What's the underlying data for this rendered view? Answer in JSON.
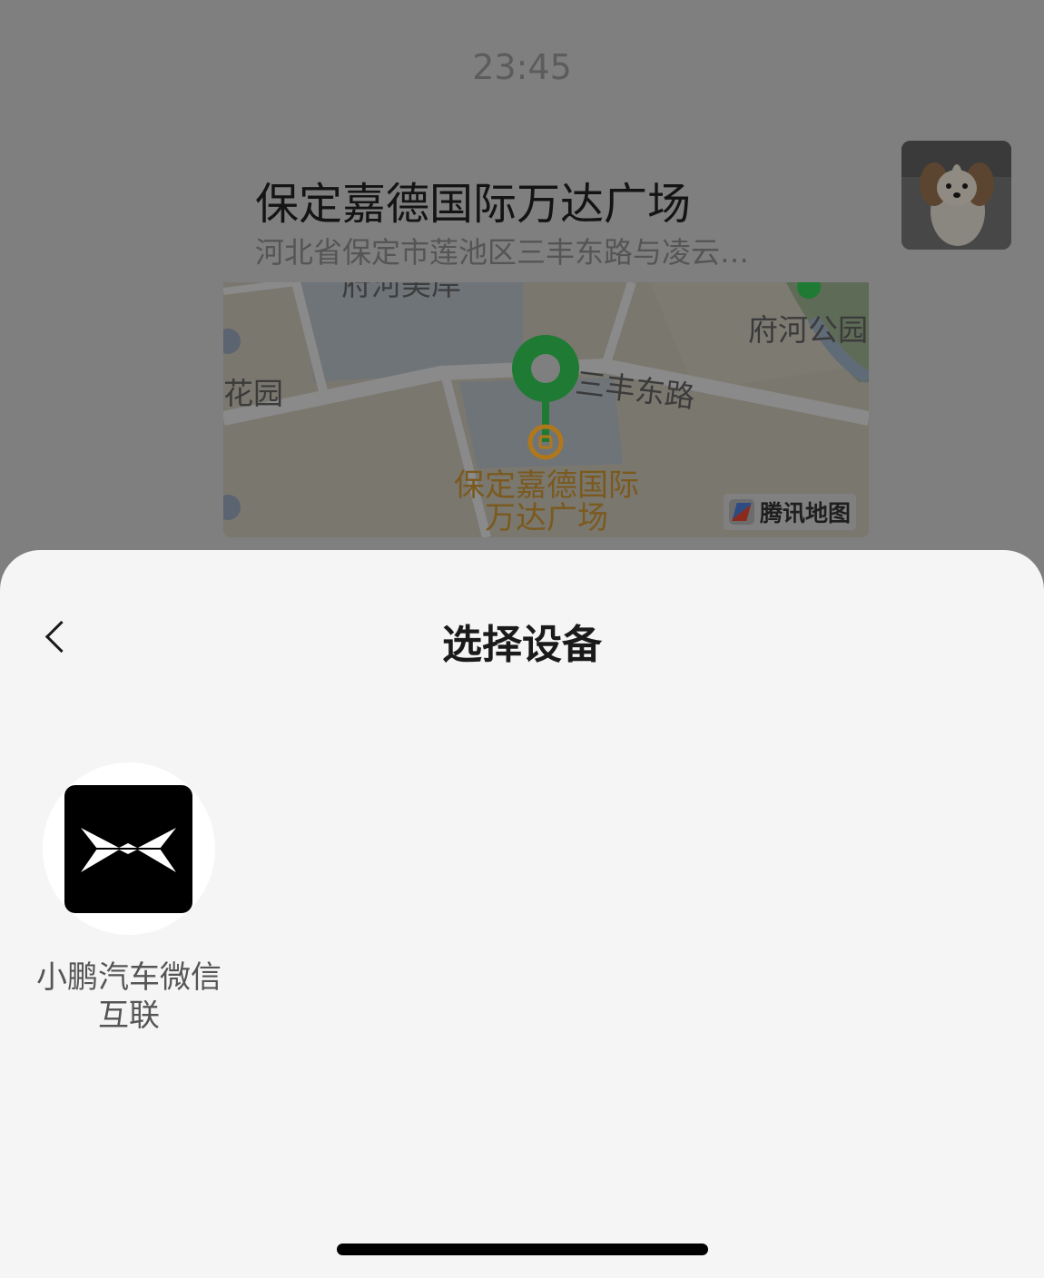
{
  "chat": {
    "time": "23:45",
    "location": {
      "title": "保定嘉德国际万达广场",
      "address": "河北省保定市莲池区三丰东路与凌云…",
      "map_labels": {
        "park": "府河公园",
        "road": "三丰东路",
        "garden": "花园",
        "top_partial": "府河美岸",
        "poi": "保定嘉德国际万达广场",
        "provider": "腾讯地图"
      }
    },
    "avatar_desc": "dog-avatar"
  },
  "sheet": {
    "title": "选择设备",
    "back_icon": "chevron-left-icon",
    "devices": [
      {
        "name": "小鹏汽车微信互联",
        "icon": "xpeng-logo-icon"
      }
    ]
  },
  "colors": {
    "overlay": "#7f7f7f",
    "sheet_bg": "#f5f5f5",
    "pin_green": "#1f7a33",
    "poi_orange": "#b0781a"
  }
}
